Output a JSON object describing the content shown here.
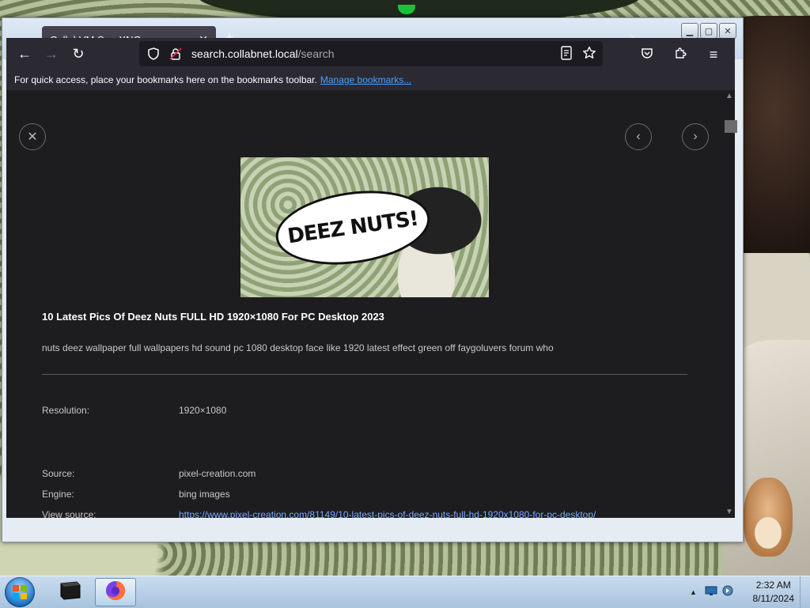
{
  "browser": {
    "tab_title": "CollabVM SearXNG",
    "url_host": "search.collabnet.local",
    "url_path": "/search",
    "bookmarks_message": "For quick access, place your bookmarks here on the bookmarks toolbar.",
    "manage_bookmarks_label": "Manage bookmarks..."
  },
  "result": {
    "image_caption": "DEEZ NUTS!",
    "title": "10 Latest Pics Of Deez Nuts FULL HD 1920×1080 For PC Desktop 2023",
    "description": "nuts deez wallpaper full wallpapers hd sound pc 1080 desktop face like 1920 latest effect green off faygoluvers forum who",
    "resolution_label": "Resolution:",
    "resolution_value": "1920×1080",
    "source_label": "Source:",
    "source_value": "pixel-creation.com",
    "engine_label": "Engine:",
    "engine_value": "bing images",
    "view_source_label": "View source:",
    "view_source_url": "https://www.pixel-creation.com/81149/10-latest-pics-of-deez-nuts-full-hd-1920x1080-for-pc-desktop/"
  },
  "taskbar": {
    "time": "2:32 AM",
    "date": "8/11/2024"
  },
  "icons": {
    "back": "back-arrow-icon",
    "forward": "forward-arrow-icon",
    "reload": "reload-icon",
    "shield": "tracking-shield-icon",
    "lock": "lock-warning-icon",
    "reader": "reader-view-icon",
    "star": "bookmark-star-icon",
    "pocket": "pocket-icon",
    "extensions": "extensions-icon",
    "menu": "hamburger-menu-icon"
  }
}
